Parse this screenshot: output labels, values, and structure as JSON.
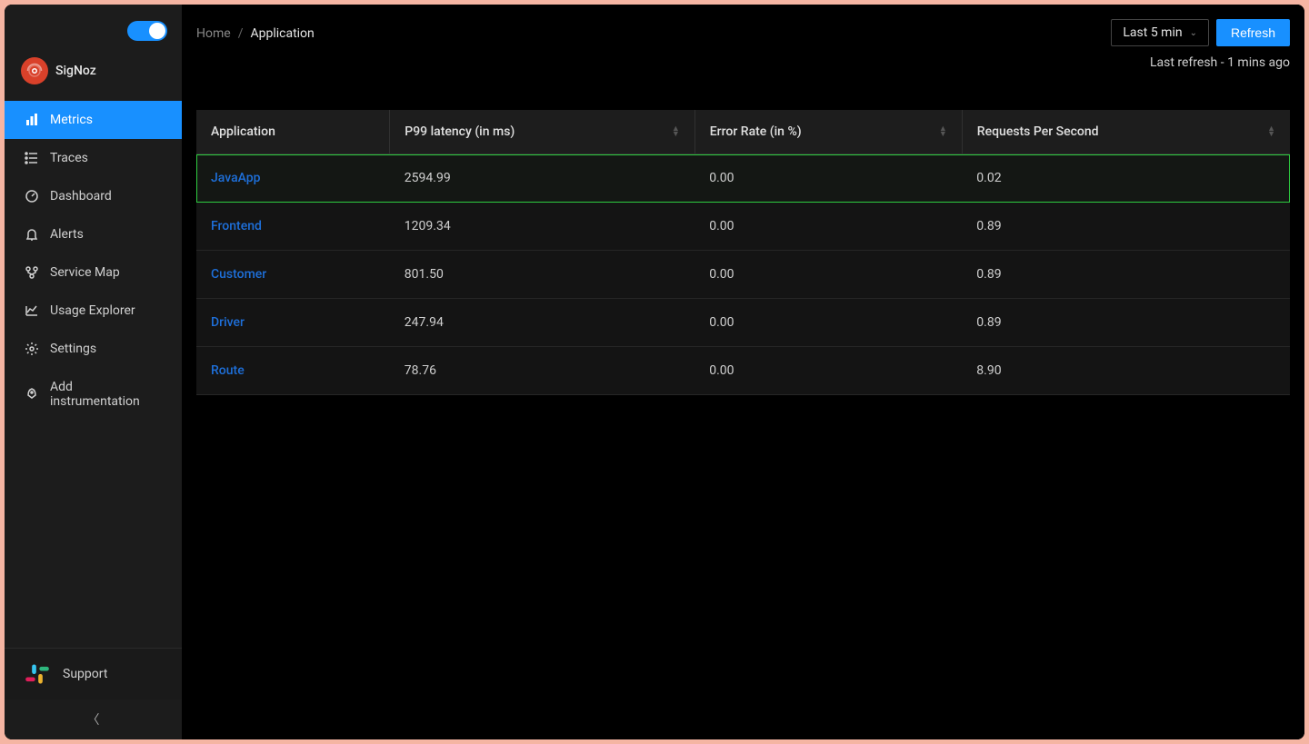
{
  "brand": {
    "name": "SigNoz"
  },
  "sidebar": {
    "items": [
      {
        "label": "Metrics",
        "icon": "bar-chart-icon",
        "active": true
      },
      {
        "label": "Traces",
        "icon": "ordered-list-icon",
        "active": false
      },
      {
        "label": "Dashboard",
        "icon": "dashboard-icon",
        "active": false
      },
      {
        "label": "Alerts",
        "icon": "bell-icon",
        "active": false
      },
      {
        "label": "Service Map",
        "icon": "services-icon",
        "active": false
      },
      {
        "label": "Usage Explorer",
        "icon": "line-chart-icon",
        "active": false
      },
      {
        "label": "Settings",
        "icon": "gear-icon",
        "active": false
      },
      {
        "label": "Add instrumentation",
        "icon": "rocket-icon",
        "active": false
      }
    ],
    "support_label": "Support"
  },
  "breadcrumb": {
    "home": "Home",
    "separator": "/",
    "current": "Application"
  },
  "controls": {
    "time_range": "Last 5 min",
    "refresh_label": "Refresh",
    "last_refresh_text": "Last refresh - 1 mins ago"
  },
  "table": {
    "columns": {
      "application": "Application",
      "p99": "P99 latency (in ms)",
      "error_rate": "Error Rate (in %)",
      "rps": "Requests Per Second"
    },
    "rows": [
      {
        "application": "JavaApp",
        "p99": "2594.99",
        "error_rate": "0.00",
        "rps": "0.02",
        "highlighted": true
      },
      {
        "application": "Frontend",
        "p99": "1209.34",
        "error_rate": "0.00",
        "rps": "0.89",
        "highlighted": false
      },
      {
        "application": "Customer",
        "p99": "801.50",
        "error_rate": "0.00",
        "rps": "0.89",
        "highlighted": false
      },
      {
        "application": "Driver",
        "p99": "247.94",
        "error_rate": "0.00",
        "rps": "0.89",
        "highlighted": false
      },
      {
        "application": "Route",
        "p99": "78.76",
        "error_rate": "0.00",
        "rps": "8.90",
        "highlighted": false
      }
    ]
  }
}
